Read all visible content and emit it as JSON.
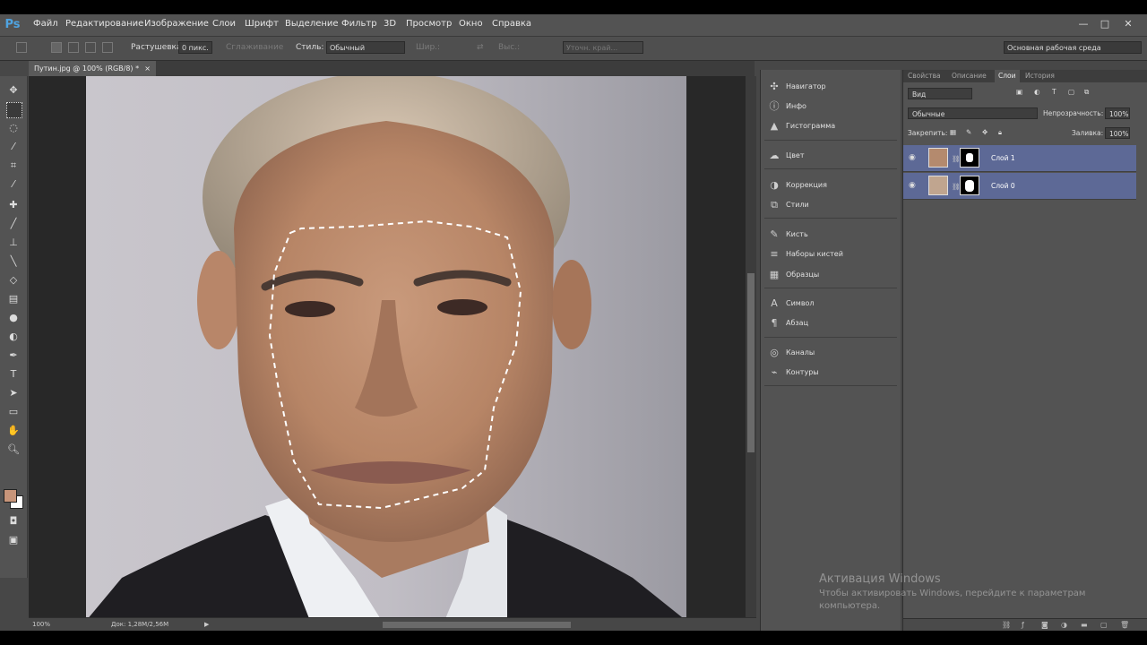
{
  "app": {
    "logo": "Ps"
  },
  "menu": [
    "Файл",
    "Редактирование",
    "Изображение",
    "Слои",
    "Шрифт",
    "Выделение",
    "Фильтр",
    "3D",
    "Просмотр",
    "Окно",
    "Справка"
  ],
  "window_controls": {
    "minimize": "—",
    "maximize": "□",
    "close": "✕"
  },
  "options": {
    "feather_label": "Растушевка:",
    "feather_value": "0 пикс.",
    "antialias_label": "Сглаживание",
    "style_label": "Стиль:",
    "style_value": "Обычный",
    "width_label": "Шир.:",
    "height_label": "Выс.:",
    "refine_label": "Уточн. край...",
    "workspace": "Основная рабочая среда"
  },
  "document": {
    "tab_title": "Путин.jpg @ 100% (RGB/8) *",
    "close": "×"
  },
  "status": {
    "zoom": "100%",
    "doc": "Док: 1,28M/2,56M"
  },
  "dock": [
    {
      "icon": "navigator-icon",
      "label": "Навигатор"
    },
    {
      "icon": "info-icon",
      "label": "Инфо"
    },
    {
      "icon": "histogram-icon",
      "label": "Гистограмма"
    },
    {
      "icon": "color-icon",
      "label": "Цвет"
    },
    {
      "icon": "adjustments-icon",
      "label": "Коррекция"
    },
    {
      "icon": "styles-icon",
      "label": "Стили"
    },
    {
      "icon": "brush-icon",
      "label": "Кисть"
    },
    {
      "icon": "brush-presets-icon",
      "label": "Наборы кистей"
    },
    {
      "icon": "swatches-icon",
      "label": "Образцы"
    },
    {
      "icon": "character-icon",
      "label": "Символ"
    },
    {
      "icon": "paragraph-icon",
      "label": "Абзац"
    },
    {
      "icon": "channels-icon",
      "label": "Каналы"
    },
    {
      "icon": "paths-icon",
      "label": "Контуры"
    }
  ],
  "layers_panel": {
    "tabs": [
      "Свойства",
      "Описание",
      "Слои",
      "История"
    ],
    "active_tab": "Слои",
    "filter": "Вид",
    "blend_mode": "Обычные",
    "opacity_label": "Непрозрачность:",
    "opacity_value": "100%",
    "lock_label": "Закрепить:",
    "fill_label": "Заливка:",
    "fill_value": "100%",
    "layers": [
      {
        "name": "Слой 1"
      },
      {
        "name": "Слой 0"
      }
    ]
  },
  "watermark": {
    "title": "Активация Windows",
    "text": "Чтобы активировать Windows, перейдите к параметрам компьютера."
  },
  "colors": {
    "accent": "#5d6996",
    "foreground": "#c8957a",
    "background": "#ffffff"
  }
}
